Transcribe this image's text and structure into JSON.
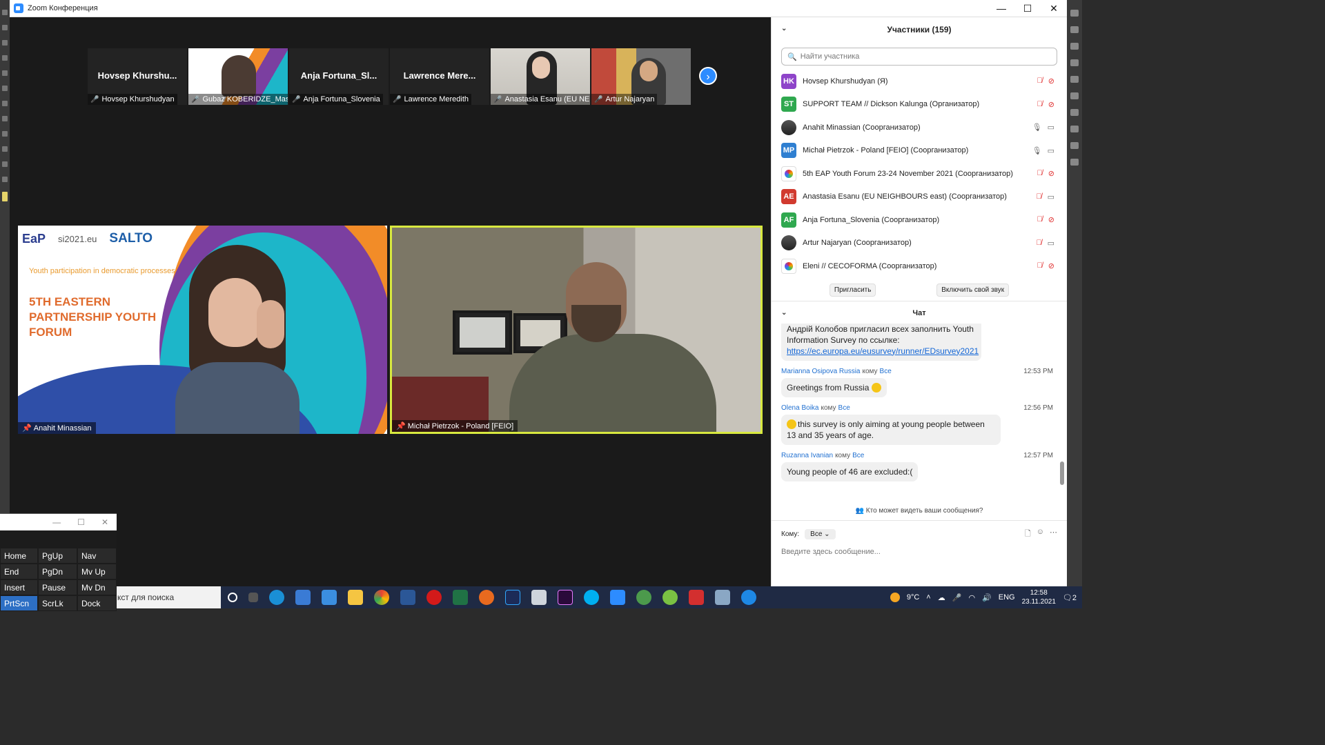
{
  "window": {
    "title": "Zoom Конференция",
    "controls": [
      "—",
      "☐",
      "✕"
    ]
  },
  "thumbnails": [
    {
      "big_name": "Hovsep  Khurshu...",
      "name": "Hovsep Khurshudyan"
    },
    {
      "big_name": "",
      "name": "Gubaz KOBERIDZE_Mast..."
    },
    {
      "big_name": "Anja  Fortuna_Sl...",
      "name": "Anja Fortuna_Slovenia"
    },
    {
      "big_name": "Lawrence  Mere...",
      "name": "Lawrence Meredith"
    },
    {
      "big_name": "",
      "name": "Anastasia Esanu (EU NEI..."
    },
    {
      "big_name": "",
      "name": "Artur Najaryan"
    }
  ],
  "next_icon": "chevron-right-icon",
  "speakers": {
    "left": {
      "name": "Anahit Minassian",
      "poster_logos": [
        "EaP",
        "si2021.eu",
        "SALTO"
      ],
      "poster_subtitle": "Youth participation in democratic processes",
      "poster_title": "5TH EASTERN PARTNERSHIP YOUTH FORUM"
    },
    "right": {
      "name": "Michał Pietrzok - Poland [FEIO]"
    }
  },
  "participants": {
    "header": "Участники (159)",
    "search_placeholder": "Найти участника",
    "list": [
      {
        "initials": "HK",
        "color": "#8e44c9",
        "name": "Hovsep Khurshudyan (Я)",
        "mic": "off",
        "cam": "off"
      },
      {
        "initials": "ST",
        "color": "#2fa84f",
        "name": "SUPPORT TEAM // Dickson Kalunga (Организатор)",
        "mic": "off",
        "cam": "off"
      },
      {
        "initials": "",
        "color": "photo",
        "name": "Anahit Minassian (Соорганизатор)",
        "mic": "on",
        "cam": "on"
      },
      {
        "initials": "MP",
        "color": "#2f7fd1",
        "name": "Michał Pietrzok - Poland [FEIO] (Соорганизатор)",
        "mic": "on",
        "cam": "on"
      },
      {
        "initials": "",
        "color": "logo",
        "name": "5th EAP  Youth Forum 23-24 November 2021 (Соорганизатор)",
        "mic": "off",
        "cam": "off"
      },
      {
        "initials": "AE",
        "color": "#d13a2f",
        "name": "Anastasia Esanu (EU NEIGHBOURS east) (Соорганизатор)",
        "mic": "off",
        "cam": "on"
      },
      {
        "initials": "AF",
        "color": "#2fa84f",
        "name": "Anja Fortuna_Slovenia (Соорганизатор)",
        "mic": "off",
        "cam": "off"
      },
      {
        "initials": "",
        "color": "photo",
        "name": "Artur Najaryan (Соорганизатор)",
        "mic": "off",
        "cam": "on"
      },
      {
        "initials": "",
        "color": "logo",
        "name": "Eleni // CECOFORMA (Соорганизатор)",
        "mic": "off",
        "cam": "off"
      }
    ],
    "invite_label": "Пригласить",
    "unmute_label": "Включить свой звук"
  },
  "chat": {
    "header": "Чат",
    "partial_message": "Андрій Колобов пригласил всех заполнить Youth Information Survey по ссылке:",
    "partial_link": "https://ec.europa.eu/eusurvey/runner/EDsurvey2021",
    "messages": [
      {
        "from": "Marianna Osipova Russia",
        "to_word": "кому",
        "to": "Все",
        "time": "12:53 PM",
        "text": "Greetings from Russia"
      },
      {
        "from": "Olena Boika",
        "to_word": "кому",
        "to": "Все",
        "time": "12:56 PM",
        "text": "this survey is only aiming at young people between 13 and 35 years of age."
      },
      {
        "from": "Ruzanna Ivanian",
        "to_word": "кому",
        "to": "Все",
        "time": "12:57 PM",
        "text": "Young people of 46 are excluded:("
      }
    ],
    "who_sees": "Кто может видеть ваши сообщения?",
    "to_label": "Кому:",
    "to_value": "Все",
    "compose_placeholder": "Введите здесь сообщение..."
  },
  "keyboard": {
    "keys": [
      "Home",
      "PgUp",
      "Nav",
      "End",
      "PgDn",
      "Mv Up",
      "Insert",
      "Pause",
      "Mv Dn",
      "PrtScn",
      "ScrLk",
      "Dock"
    ]
  },
  "taskbar": {
    "search_text": "кст для поиска",
    "weather": "9°C",
    "lang": "ENG",
    "time": "12:58",
    "date": "23.11.2021",
    "notifications": "2"
  }
}
